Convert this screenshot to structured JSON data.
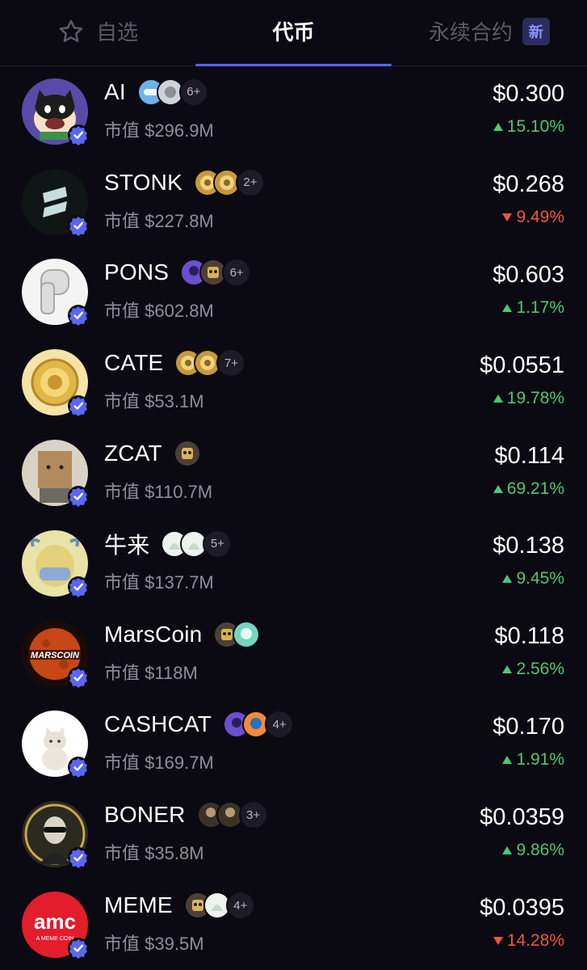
{
  "tabs": [
    {
      "label": "自选",
      "icon": "star-icon",
      "active": false
    },
    {
      "label": "代币",
      "active": true
    },
    {
      "label": "永续合约",
      "badge": "新",
      "active": false
    }
  ],
  "colors": {
    "background": "#0b0a12",
    "accent": "#5a63f0",
    "up": "#4fc672",
    "down": "#f0563c",
    "verified": "#5b66f2"
  },
  "mcap_prefix": "市值",
  "tokens": [
    {
      "name": "AI",
      "holder_count": "6+",
      "holder_icons": [
        "blue-disc-icon",
        "grey-avatar-icon"
      ],
      "market_cap": "$296.9M",
      "price": "$0.300",
      "change": "15.10%",
      "direction": "up",
      "avatar": "cat-mascot"
    },
    {
      "name": "STONK",
      "holder_count": "2+",
      "holder_icons": [
        "gold-coin-icon",
        "gold-coin-icon"
      ],
      "market_cap": "$227.8M",
      "price": "$0.268",
      "change": "9.49%",
      "direction": "down",
      "avatar": "stonk-logo"
    },
    {
      "name": "PONS",
      "holder_count": "6+",
      "holder_icons": [
        "purple-avatar-icon",
        "robot-avatar-icon"
      ],
      "market_cap": "$602.8M",
      "price": "$0.603",
      "change": "1.17%",
      "direction": "up",
      "avatar": "pons-logo"
    },
    {
      "name": "CATE",
      "holder_count": "7+",
      "holder_icons": [
        "gold-coin-icon",
        "gold-coin-icon"
      ],
      "market_cap": "$53.1M",
      "price": "$0.0551",
      "change": "19.78%",
      "direction": "up",
      "avatar": "gold-coin"
    },
    {
      "name": "ZCAT",
      "holder_count": "",
      "holder_icons": [
        "robot-avatar-icon"
      ],
      "market_cap": "$110.7M",
      "price": "$0.114",
      "change": "69.21%",
      "direction": "up",
      "avatar": "box-cat"
    },
    {
      "name": "牛来",
      "holder_count": "5+",
      "holder_icons": [
        "white-avatar-icon",
        "white-avatar-icon"
      ],
      "market_cap": "$137.7M",
      "price": "$0.138",
      "change": "9.45%",
      "direction": "up",
      "avatar": "bull-mask"
    },
    {
      "name": "MarsCoin",
      "holder_count": "",
      "holder_icons": [
        "robot-avatar-icon",
        "teal-avatar-icon"
      ],
      "market_cap": "$118M",
      "price": "$0.118",
      "change": "2.56%",
      "direction": "up",
      "avatar": "mars-planet"
    },
    {
      "name": "CASHCAT",
      "holder_count": "4+",
      "holder_icons": [
        "purple-avatar-icon",
        "orange-avatar-icon"
      ],
      "market_cap": "$169.7M",
      "price": "$0.170",
      "change": "1.91%",
      "direction": "up",
      "avatar": "white-cat"
    },
    {
      "name": "BONER",
      "holder_count": "3+",
      "holder_icons": [
        "dark-avatar-icon",
        "dark-avatar-icon"
      ],
      "market_cap": "$35.8M",
      "price": "$0.0359",
      "change": "9.86%",
      "direction": "up",
      "avatar": "statue"
    },
    {
      "name": "MEME",
      "holder_count": "4+",
      "holder_icons": [
        "robot-avatar-icon",
        "white-avatar-icon"
      ],
      "market_cap": "$39.5M",
      "price": "$0.0395",
      "change": "14.28%",
      "direction": "down",
      "avatar": "amc-logo",
      "avatar_text": "amc",
      "avatar_subtext": "A MEME COIN"
    }
  ]
}
